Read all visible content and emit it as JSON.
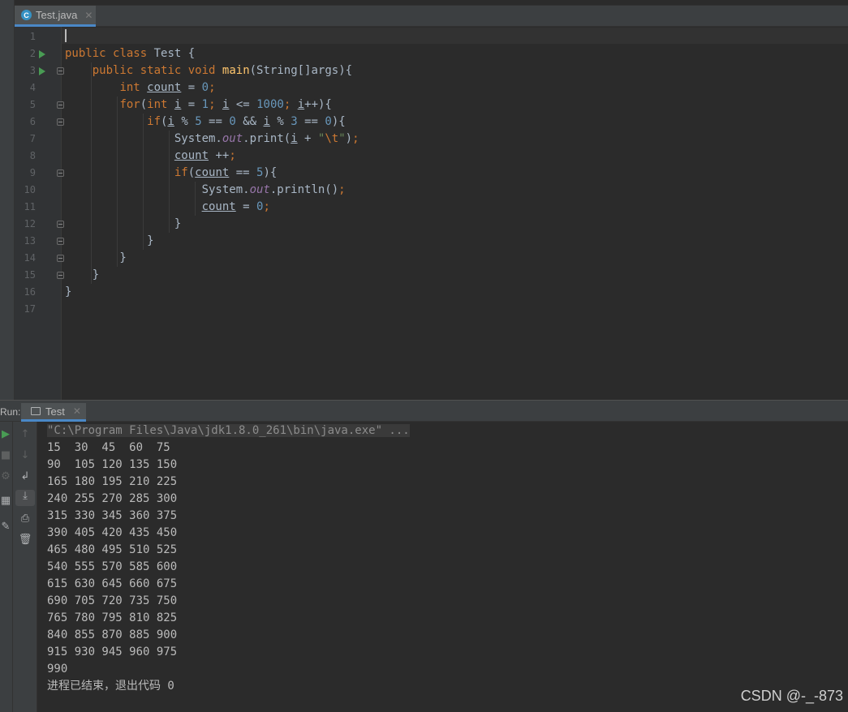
{
  "editor": {
    "tab_label": "Test.java",
    "file_icon_letter": "C",
    "line_numbers": [
      "1",
      "2",
      "3",
      "4",
      "5",
      "6",
      "7",
      "8",
      "9",
      "10",
      "11",
      "12",
      "13",
      "14",
      "15",
      "16",
      "17"
    ],
    "lines": [
      "",
      "public class Test {",
      "    public static void main(String[]args){",
      "        int count = 0;",
      "        for(int i = 1; i <= 1000; i++){",
      "            if(i % 5 == 0 && i % 3 == 0){",
      "                System.out.print(i + \"\\t\");",
      "                count ++;",
      "                if(count == 5){",
      "                    System.out.println();",
      "                    count = 0;",
      "                }",
      "            }",
      "        }",
      "    }",
      "}",
      ""
    ]
  },
  "run_panel": {
    "label": "Run:",
    "tab_label": "Test",
    "command": "\"C:\\Program Files\\Java\\jdk1.8.0_261\\bin\\java.exe\" ...",
    "output": [
      "15  30  45  60  75",
      "90  105 120 135 150",
      "165 180 195 210 225",
      "240 255 270 285 300",
      "315 330 345 360 375",
      "390 405 420 435 450",
      "465 480 495 510 525",
      "540 555 570 585 600",
      "615 630 645 660 675",
      "690 705 720 735 750",
      "765 780 795 810 825",
      "840 855 870 885 900",
      "915 930 945 960 975",
      "990",
      "进程已结束，退出代码 0"
    ]
  },
  "watermark": "CSDN @-_-873",
  "colors": {
    "keyword": "#cc7832",
    "number": "#6897bb",
    "string": "#6a8759",
    "method": "#ffc66d",
    "static_field": "#9876aa",
    "background": "#2b2b2b"
  }
}
